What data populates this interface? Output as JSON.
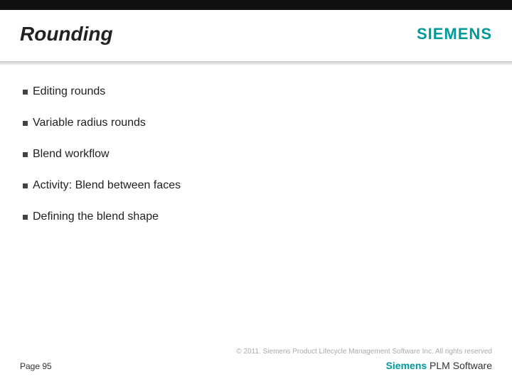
{
  "header": {
    "title": "Rounding",
    "logo": "SIEMENS"
  },
  "bullets": [
    "Editing rounds",
    "Variable radius rounds",
    "Blend workflow",
    "Activity: Blend between faces",
    "Defining the blend shape"
  ],
  "footer": {
    "copyright": "© 2011. Siemens Product Lifecycle Management Software Inc. All rights reserved",
    "page": "Page 95",
    "brand_primary": "Siemens",
    "brand_secondary": " PLM Software"
  }
}
